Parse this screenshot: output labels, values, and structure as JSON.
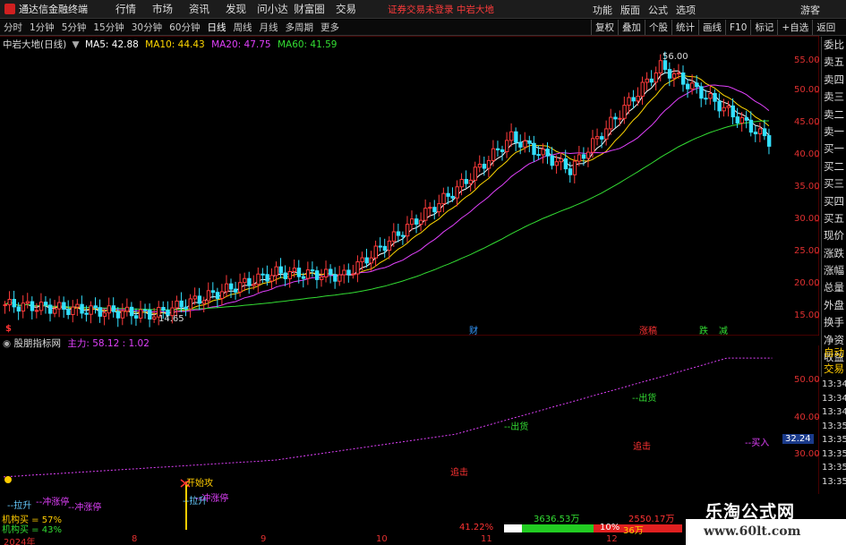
{
  "titlebar": {
    "app_title": "通达信金融终端",
    "menu": [
      "行情",
      "市场",
      "资讯",
      "发现",
      "问小达",
      "财富圈",
      "交易"
    ],
    "notice": "证券交易未登录  中岩大地",
    "right": [
      "功能",
      "版面",
      "公式",
      "选项"
    ],
    "guest": "游客"
  },
  "periodbar": {
    "periods": [
      "分时",
      "1分钟",
      "5分钟",
      "15分钟",
      "30分钟",
      "60分钟",
      "日线",
      "周线",
      "月线",
      "多周期",
      "更多"
    ],
    "active": "日线",
    "right": [
      "复权",
      "叠加",
      "个股",
      "统计",
      "画线",
      "F10",
      "标记",
      "+自选",
      "返回"
    ]
  },
  "main": {
    "stock": "中岩大地(日线)",
    "ma": [
      {
        "label": "MA5: 42.88",
        "color": "#ffffff"
      },
      {
        "label": "MA10: 44.43",
        "color": "#ffd700"
      },
      {
        "label": "MA20: 47.75",
        "color": "#e040fb"
      },
      {
        "label": "MA60: 41.59",
        "color": "#33dd33"
      }
    ],
    "y_ticks": [
      "55.00",
      "50.00",
      "45.00",
      "40.00",
      "35.00",
      "30.00",
      "25.00",
      "20.00",
      "15.00"
    ],
    "high_label": "56.00",
    "low_label": "14.65",
    "tags": [
      {
        "t": "$",
        "c": "#ff3333"
      },
      {
        "t": "财",
        "c": "#3399ff"
      },
      {
        "t": "涨稿",
        "c": "#ff3333"
      },
      {
        "t": "跌",
        "c": "#33dd33"
      },
      {
        "t": "减",
        "c": "#33dd33"
      }
    ]
  },
  "sub": {
    "indicator": "股朋指标网",
    "main_label": "主力: 58.12 : 1.02",
    "y_ticks": [
      "50.00",
      "40.00",
      "30.00"
    ],
    "value_box": "32.24",
    "labels": {
      "out1": "出货",
      "out2": "出货",
      "buy": "买入",
      "chase1": "追击",
      "chase2": "追击",
      "start": "开始攻",
      "pull1": "拉升",
      "pull2": "拉升",
      "limit1": "冲涨停",
      "limit2": "冲涨停",
      "limit3": "冲涨停",
      "inst1": "机构买 = 57%",
      "inst2": "机构买 = 43%"
    },
    "bottom": {
      "pct1": "41.22%",
      "amt1": "3636.53万",
      "amt2": "2550.17万",
      "pct2": "10%",
      "v3": "36万"
    }
  },
  "xaxis": [
    "2024年",
    "8",
    "9",
    "10",
    "11",
    "12"
  ],
  "side": {
    "items": [
      "委比",
      "卖五",
      "卖四",
      "卖三",
      "卖二",
      "卖一",
      "买一",
      "买二",
      "买三",
      "买四",
      "买五",
      "现价",
      "涨跌",
      "涨幅",
      "总量",
      "外盘",
      "换手",
      "净资",
      "收益",
      "自动",
      "交易"
    ],
    "times": [
      "13:34",
      "13:34",
      "13:34",
      "13:35",
      "13:35",
      "13:35",
      "13:35",
      "13:35",
      "13:35"
    ]
  },
  "watermark": {
    "title": "乐淘公式网",
    "url": "www.60lt.com"
  },
  "chart_data": {
    "type": "line",
    "series": [
      {
        "name": "MA5",
        "values": [
          42.88
        ]
      },
      {
        "name": "MA10",
        "values": [
          44.43
        ]
      },
      {
        "name": "MA20",
        "values": [
          47.75
        ]
      },
      {
        "name": "MA60",
        "values": [
          41.59
        ]
      }
    ],
    "ylim": [
      14,
      58
    ],
    "high": 56.0,
    "low": 14.65
  }
}
